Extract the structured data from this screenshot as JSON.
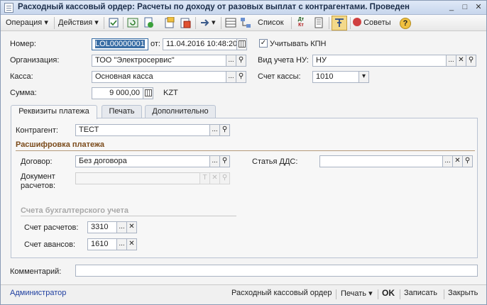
{
  "window": {
    "title": "Расходный кассовый ордер: Расчеты по доходу от разовых выплат с контрагентами. Проведен",
    "buttons": {
      "minimize": "_",
      "maximize": "□",
      "close": "✕"
    }
  },
  "toolbar": {
    "operation": "Операция",
    "actions": "Действия",
    "list": "Список",
    "dt_kt_top": "Дт",
    "dt_kt_bottom": "Кт",
    "advice": "Советы",
    "dropdown_glyph": "▾",
    "help_glyph": "?"
  },
  "header": {
    "number_label": "Номер:",
    "number_value": "LOL00000001",
    "date_label": "от:",
    "date_value": "11.04.2016 10:48:20",
    "kpn_checked": true,
    "kpn_label": "Учитывать КПН",
    "org_label": "Организация:",
    "org_value": "ТОО \"Электросервис\"",
    "nu_label": "Вид учета НУ:",
    "nu_value": "НУ",
    "cash_label": "Касса:",
    "cash_value": "Основная касса",
    "cash_account_label": "Счет кассы:",
    "cash_account_value": "1010",
    "sum_label": "Сумма:",
    "sum_value": "9 000,00",
    "currency": "KZT"
  },
  "glyphs": {
    "ellipsis": "...",
    "clear": "✕",
    "check": "✓",
    "search": "⚲",
    "T": "T",
    "arrow_down": "▾"
  },
  "tabs": [
    {
      "label": "Реквизиты платежа",
      "active": true
    },
    {
      "label": "Печать",
      "active": false
    },
    {
      "label": "Дополнительно",
      "active": false
    }
  ],
  "payment": {
    "counterparty_label": "Контрагент:",
    "counterparty_value": "ТЕСТ",
    "breakdown_title": "Расшифровка платежа",
    "contract_label": "Договор:",
    "contract_value": "Без договора",
    "dds_label": "Статья ДДС:",
    "dds_value": "",
    "settlement_doc_label_1": "Документ",
    "settlement_doc_label_2": "расчетов:",
    "settlement_doc_value": "",
    "accounts_title": "Счета бухгалтерского учета",
    "settle_account_label": "Счет расчетов:",
    "settle_account_value": "3310",
    "advance_account_label": "Счет авансов:",
    "advance_account_value": "1610"
  },
  "comment": {
    "label": "Комментарий:",
    "value": ""
  },
  "footer": {
    "user": "Администратор",
    "doc_print": "Расходный кассовый ордер",
    "print": "Печать",
    "ok": "OK",
    "save": "Записать",
    "close": "Закрыть"
  },
  "colors": {
    "accent": "#1f3fa0",
    "section": "#7a4a1a",
    "selection": "#3a6ea5"
  }
}
